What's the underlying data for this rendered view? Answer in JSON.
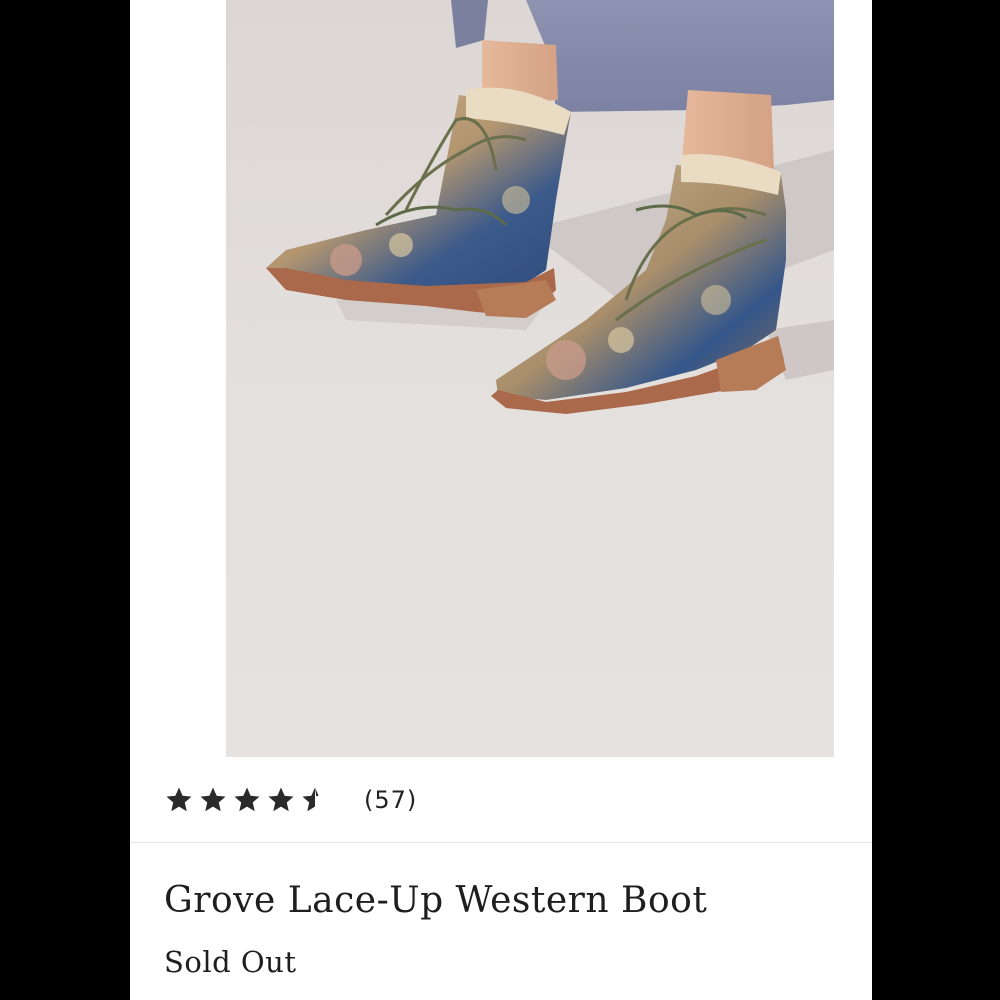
{
  "product": {
    "title": "Grove Lace-Up Western Boot",
    "status": "Sold Out",
    "rating": {
      "value": 4.5,
      "max": 5,
      "count_label": "(57)"
    },
    "image_icon": "product-photo-boots"
  },
  "colors": {
    "background": "#000000",
    "card": "#ffffff",
    "star": "#2a2a2a",
    "text": "#1e1e1e"
  }
}
